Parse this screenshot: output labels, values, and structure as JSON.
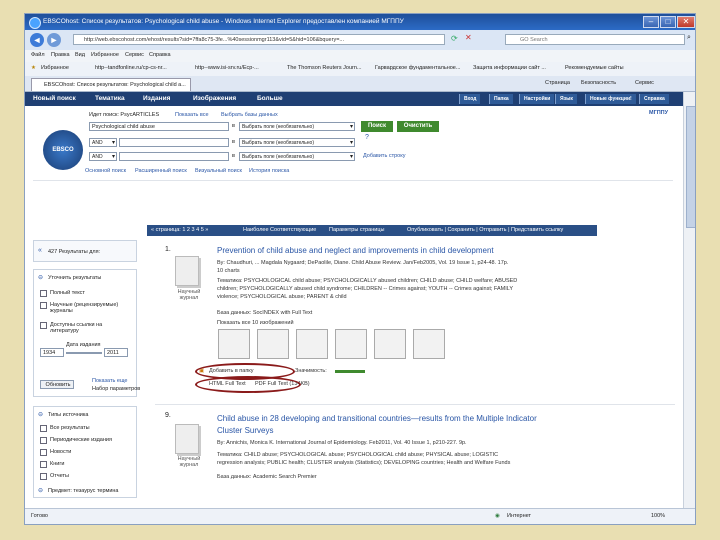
{
  "window": {
    "title": "EBSCOhost: Список результатов: Psychological child abuse - Windows Internet Explorer предоставлен компанией МГППУ",
    "min": "–",
    "max": "□",
    "close": "✕"
  },
  "address": {
    "url": "http://web.ebscohost.com/ehost/results?sid=7ffa8c75-3fe...%40sessionmgr113&vid=5&hid=106&bquery=...",
    "search_placeholder": "GO Search"
  },
  "menu": [
    "Файл",
    "Правка",
    "Вид",
    "Избранное",
    "Сервис",
    "Справка"
  ],
  "favorites": {
    "label": "Избранное",
    "items": [
      "http--tandfonline.ru/cp-cs-nr...",
      "http--www.isi-srv.ru/Ecp-...",
      "The Thomson Reuters Journ...",
      "Гарвардское фундаментальное...",
      "Защита информации сайт ...",
      "Рекомендуемые сайты"
    ]
  },
  "tab": {
    "label": "EBSCOhost: Список результатов: Psychological child a..."
  },
  "tabtools": [
    "Страница",
    "Безопасность",
    "Сервис"
  ],
  "eb": {
    "nav": [
      "Новый поиск",
      "Тематика",
      "Издания",
      "Изображения",
      "Больше"
    ],
    "right": [
      "Вход",
      "Папка",
      "Настройки",
      "Язык",
      "Новые функции!",
      "Справка"
    ],
    "msgpu": "МГППУ",
    "logo": "EBSCO",
    "search_in": "Идет поиск: PsycARTICLES",
    "show_all": "Показать все",
    "choose_db": "Выбрать базы данных",
    "query": "Psychological child abuse",
    "field1": "Выбрать поле (необязательно)",
    "op": "AND",
    "in": "в",
    "search_btn": "Поиск",
    "clear_btn": "Очистить",
    "add_row": "Добавить строку",
    "links": [
      "Основной поиск",
      "Расширенный поиск",
      "Визуальный поиск",
      "История поиска"
    ]
  },
  "resultsbar": {
    "pages": "« страница: 1 2 3 4 5 »",
    "sort": "Наиболее Соответствующие",
    "page_opt": "Параметры страницы",
    "share": "Опубликовать | Сохранить | Отправить | Представить ссылку"
  },
  "side": {
    "count": "427 Результаты для:",
    "refine": "Уточнить результаты",
    "full_text": "Полный текст",
    "scholarly": "Научные (рецензируемые) журналы",
    "linked": "Доступны ссылки на литературу",
    "pubdate": "Дата издания",
    "from": "1934",
    "to": "2011",
    "update": "Обновить",
    "show_more": "Показать еще",
    "options": "Набор параметров",
    "source_types": "Типы источника",
    "types": [
      "Все результаты",
      "Периодические издания",
      "Новости",
      "Книги",
      "Отчеты"
    ],
    "subject": "Предмет: тезаурус термина"
  },
  "results": [
    {
      "num": "1.",
      "title": "Prevention of child abuse and neglect and improvements in child development",
      "by": "By: Chaudhuri, ... Magdala Nygaard; DePaolile, Diane. Child Abuse Review. Jan/Feb2005, Vol. 19 Issue 1, p24-48. 17p.",
      "line2": "10 charts",
      "subjects": "Тематика: PSYCHOLOGICAL child abuse; PSYCHOLOGICALLY abused children; CHILD abuse; CHILD welfare; ABUSED",
      "subjects2": "children; PSYCHOLOGICALLY abused child syndrome; CHILDREN -- Crimes against; YOUTH -- Crimes against; FAMILY",
      "subjects3": "violence; PSYCHOLOGICAL abuse; PARENT & child",
      "db": "База данных: SocINDEX with Full Text",
      "images": "Показать все 10 изображений",
      "type": "Научный журнал",
      "add": "Добавить в папку",
      "relevance": "Значимость:",
      "html": "HTML Full Text",
      "pdf": "PDF Full Text (134KB)"
    },
    {
      "num": "9.",
      "title": "Child abuse in 28 developing and transitional countries—results from the Multiple Indicator",
      "title2": "Cluster Surveys",
      "by": "By: Annichis, Monica K. International Journal of Epidemiology. Feb2011, Vol. 40 Issue 1, p210-227. 9p.",
      "subjects": "Тематика: CHILD abuse; PSYCHOLOGICAL abuse; PSYCHOLOGICAL child abuse; PHYSICAL abuse; LOGISTIC",
      "subjects2": "regression analysis; PUBLIC health; CLUSTER analysis (Statistics); DEVELOPING countries; Health and Welfare Funds",
      "db": "База данных: Academic Search Premier",
      "type": "Научный журнал"
    }
  ],
  "status": {
    "done": "Готово",
    "zone": "Интернет",
    "zoom": "100%"
  }
}
